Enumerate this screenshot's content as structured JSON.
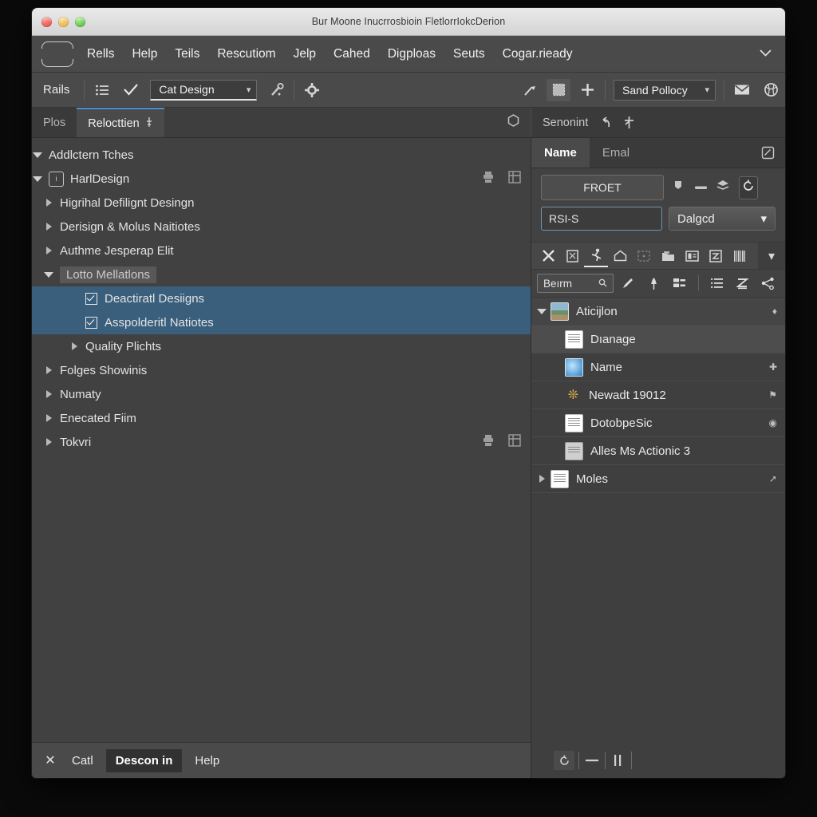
{
  "window": {
    "title": "Bur Moone Inucrrosbioin FletlorrIokcDerion",
    "traffic_lights": [
      "close",
      "minimize",
      "maximize"
    ]
  },
  "menubar": {
    "logo_icon": "app-logo-icon",
    "items": [
      "Rells",
      "Help",
      "Teils",
      "Rescutiom",
      "Jelp",
      "Cahed",
      "Digploas",
      "Seuts",
      "Cogar.rieady"
    ],
    "overflow_icon": "chevron-down-icon"
  },
  "toolbar": {
    "app_label": "Rails",
    "icons_left": [
      "list-icon",
      "check-icon"
    ],
    "design_combo": {
      "value": "Cat Design",
      "caret": "chevron-down-icon"
    },
    "icons_mid": [
      "wand-icon",
      "gear-icon"
    ],
    "icons_right": [
      "brush-icon",
      "stamp-icon",
      "plus-icon"
    ],
    "policy_combo": {
      "value": "Sand Pollocy",
      "caret": "chevron-down-icon"
    },
    "icons_far_right": [
      "mail-icon",
      "globe-icon"
    ]
  },
  "tabstrip": {
    "tabs": [
      {
        "label": "Plos",
        "active": false,
        "pin": ""
      },
      {
        "label": "Relocttien",
        "active": true,
        "pin": "pin-icon"
      }
    ],
    "mid_icon": "hexagon-icon",
    "right_label": "Senonint",
    "right_icons": [
      "undo-icon",
      "branch-icon"
    ]
  },
  "tree": {
    "rows": [
      {
        "label": "Addlctern Tches",
        "indent": 0,
        "twisty": "open",
        "kind": "group",
        "selected": false,
        "highlight": false,
        "tools": false
      },
      {
        "label": "HarlDesign",
        "indent": 0,
        "twisty": "open",
        "kind": "fileicon",
        "selected": false,
        "highlight": false,
        "tools": true
      },
      {
        "label": "Higrihal Defilignt Desingn",
        "indent": 1,
        "twisty": "closed",
        "kind": "plain",
        "selected": false,
        "highlight": false,
        "tools": false
      },
      {
        "label": "Derisign & Molus Naitiotes",
        "indent": 1,
        "twisty": "closed",
        "kind": "plain",
        "selected": false,
        "highlight": false,
        "tools": false
      },
      {
        "label": "Authme Jesperap Elit",
        "indent": 1,
        "twisty": "closed",
        "kind": "plain",
        "selected": false,
        "highlight": false,
        "tools": false
      },
      {
        "label": "Lotto Mellatlons",
        "indent": 1,
        "twisty": "open",
        "kind": "plain",
        "selected": false,
        "highlight": true,
        "tools": false
      },
      {
        "label": "Deactiratl Desiigns",
        "indent": 2,
        "twisty": "none",
        "kind": "check",
        "selected": true,
        "highlight": false,
        "tools": false
      },
      {
        "label": "Asspolderitl Natiotes",
        "indent": 2,
        "twisty": "none",
        "kind": "check",
        "selected": true,
        "highlight": false,
        "tools": false
      },
      {
        "label": "Quality Plichts",
        "indent": 2,
        "twisty": "closed",
        "kind": "plain",
        "selected": false,
        "highlight": false,
        "tools": false
      },
      {
        "label": "Folges Showinis",
        "indent": 1,
        "twisty": "closed",
        "kind": "plain",
        "selected": false,
        "highlight": false,
        "tools": false
      },
      {
        "label": "Numaty",
        "indent": 1,
        "twisty": "closed",
        "kind": "plain",
        "selected": false,
        "highlight": false,
        "tools": false
      },
      {
        "label": "Enecated Fiim",
        "indent": 1,
        "twisty": "closed",
        "kind": "plain",
        "selected": false,
        "highlight": false,
        "tools": false
      },
      {
        "label": "Tokvri",
        "indent": 1,
        "twisty": "closed",
        "kind": "plain",
        "selected": false,
        "highlight": false,
        "tools": true
      }
    ]
  },
  "left_footer": {
    "close_icon": "close-x-icon",
    "buttons": [
      {
        "label": "Catl",
        "dark": false
      },
      {
        "label": "Descon in",
        "dark": true
      },
      {
        "label": "Help",
        "dark": false
      }
    ]
  },
  "right_panel": {
    "tabs": [
      {
        "label": "Name",
        "active": true
      },
      {
        "label": "Emal",
        "active": false
      }
    ],
    "tab_edge_icon": "edit-square-icon",
    "action_button": "FROET",
    "mini_icons": [
      "tag-icon",
      "minus-icon",
      "layers-icon",
      "refresh-icon"
    ],
    "text_input": {
      "value": "RSI-S",
      "placeholder": "RSI-S"
    },
    "select": {
      "value": "Dalgcd",
      "caret": "chevron-down-icon"
    },
    "icon_row_1": [
      "close-x-icon",
      "clipboard-icon",
      "person-run-icon",
      "home-icon",
      "dashed-box-icon",
      "folder-icon",
      "id-card-icon",
      "save-icon",
      "barcode-icon"
    ],
    "icon_row_1_overflow": "chevron-down-icon",
    "search": {
      "value": "Beırm",
      "icon": "search-icon"
    },
    "icon_row_2": [
      "pencil-icon",
      "pin-icon",
      "layout-icon",
      "list-numbered-icon",
      "sort-z-icon",
      "node-link-icon"
    ],
    "list": [
      {
        "label": "Aticijlon",
        "icon": "photo-thumb-icon",
        "twisty": "open",
        "indent": 0,
        "state": "header",
        "end_icon": "drop-icon"
      },
      {
        "label": "Dıanage",
        "icon": "document-icon",
        "twisty": "none",
        "indent": 1,
        "state": "hover",
        "end_icon": ""
      },
      {
        "label": "Name",
        "icon": "image-blue-icon",
        "twisty": "none",
        "indent": 1,
        "state": "normal",
        "end_icon": "pin-icon"
      },
      {
        "label": "Newadt 19012",
        "icon": "star-burst-icon",
        "twisty": "none",
        "indent": 1,
        "state": "normal",
        "end_icon": "flag-icon"
      },
      {
        "label": "DotobpeSic",
        "icon": "document-icon",
        "twisty": "none",
        "indent": 1,
        "state": "normal",
        "end_icon": "eye-icon"
      },
      {
        "label": "Alles Ms Actionic 3",
        "icon": "grey-doc-icon",
        "twisty": "none",
        "indent": 1,
        "state": "normal",
        "end_icon": ""
      },
      {
        "label": "Moles",
        "icon": "document-icon",
        "twisty": "closed",
        "indent": 0,
        "state": "normal",
        "end_icon": "link-icon"
      }
    ],
    "footer_icons": [
      "refresh-icon",
      "minus-icon",
      "columns-icon"
    ]
  },
  "colors": {
    "window_bg": "#414141",
    "chrome": "#4a4a4a",
    "selection_blue": "#3a5f7d",
    "accent_tab": "#4c8fd4",
    "input_border": "#6f95b5",
    "titlebar": "#e2e2e2"
  }
}
